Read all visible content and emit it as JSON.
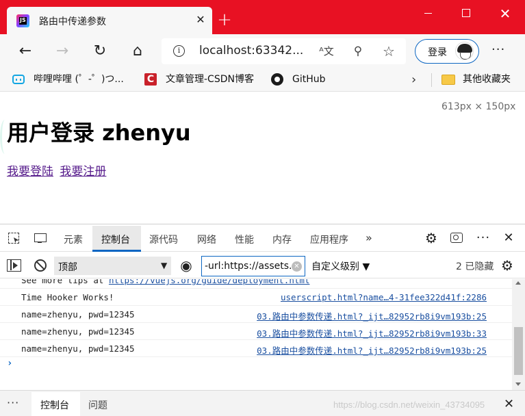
{
  "browser": {
    "tab_title": "路由中传递参数",
    "favicon_letters": "JS",
    "url": "localhost:63342...",
    "login_label": "登录",
    "colors": {
      "titlebar": "#e81123",
      "accent": "#0c66c2"
    }
  },
  "favorites": {
    "items": [
      {
        "label": "哔哩哔哩 (゜-゜)つ...",
        "icon": "bilibili-icon"
      },
      {
        "label": "文章管理-CSDN博客",
        "icon": "csdn-icon"
      },
      {
        "label": "GitHub",
        "icon": "github-icon"
      }
    ],
    "other_label": "其他收藏夹"
  },
  "page": {
    "dimension_label": "613px × 150px",
    "title": "用户登录 zhenyu",
    "links": [
      "我要登陆",
      "我要注册"
    ]
  },
  "devtools": {
    "tabs": [
      "元素",
      "控制台",
      "源代码",
      "网络",
      "性能",
      "内存",
      "应用程序"
    ],
    "active_tab": "控制台",
    "context": "顶部",
    "filter_value": "-url:https://assets.r",
    "levels_label": "自定义级别 ▼",
    "hidden_label": "2 已隐藏",
    "console": [
      {
        "message": "See more tips at ",
        "link": "https://vuejs.org/guide/deployment.html",
        "source": ""
      },
      {
        "message": "Time Hooker Works!",
        "link": "",
        "source": "userscript.html?name…4-31fee322d41f:2286"
      },
      {
        "message": "name=zhenyu, pwd=12345",
        "link": "",
        "source": "03.路由中参数传递.html?_ijt…82952rb8i9vm193b:25"
      },
      {
        "message": "name=zhenyu, pwd=12345",
        "link": "",
        "source": "03.路由中参数传递.html?_ijt…82952rb8i9vm193b:33"
      },
      {
        "message": "name=zhenyu, pwd=12345",
        "link": "",
        "source": "03.路由中参数传递.html?_ijt…82952rb8i9vm193b:25"
      }
    ],
    "prompt": "›",
    "drawer_tabs": [
      "控制台",
      "问题"
    ],
    "watermark": "https://blog.csdn.net/weixin_43734095"
  }
}
